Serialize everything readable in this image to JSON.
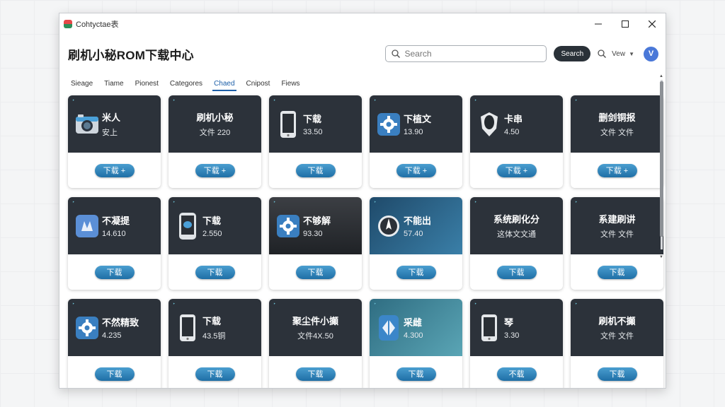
{
  "window": {
    "title": "Cohtyctae表"
  },
  "header": {
    "title": "刷机小秘ROM下载中心",
    "search_placeholder": "Search",
    "search_button": "Search",
    "view_label": "Vew",
    "avatar_letter": "V"
  },
  "tabs": [
    "Sieage",
    "Tiame",
    "Pionest",
    "Categores",
    "Chaed",
    "Cnipost",
    "Fiews"
  ],
  "active_tab": "Chaed",
  "cards": [
    {
      "title": "米人",
      "sub": "安上",
      "button": "下载 +",
      "icon": "camera-icon",
      "style": "dark"
    },
    {
      "title": "刷机小秘",
      "sub": "文件 220",
      "button": "下载 +",
      "icon": "",
      "style": "dark"
    },
    {
      "title": "下载",
      "sub": "33.50",
      "button": "下载",
      "icon": "phone-icon",
      "style": "dark"
    },
    {
      "title": "下植文",
      "sub": "13.90",
      "button": "下载 +",
      "icon": "gear-icon",
      "style": "dark"
    },
    {
      "title": "卡串",
      "sub": "4.50",
      "button": "下载 +",
      "icon": "shield-icon",
      "style": "dark"
    },
    {
      "title": "删剑铜报",
      "sub": "文件 文件",
      "button": "下载 +",
      "icon": "",
      "style": "dark"
    },
    {
      "title": "不凝提",
      "sub": "14.610",
      "button": "下载",
      "icon": "app-icon",
      "style": "dark"
    },
    {
      "title": "下载",
      "sub": "2.550",
      "button": "下载",
      "icon": "phone-msg-icon",
      "style": "dark"
    },
    {
      "title": "不够解",
      "sub": "93.30",
      "button": "下载",
      "icon": "gear-icon",
      "style": "photo"
    },
    {
      "title": "不能出",
      "sub": "57.40",
      "button": "下载",
      "icon": "compass-icon",
      "style": "blue"
    },
    {
      "title": "系统刷化分",
      "sub": "这体文文通",
      "button": "下载",
      "icon": "",
      "style": "dark"
    },
    {
      "title": "系建刷讲",
      "sub": "文件 文件",
      "button": "下载",
      "icon": "",
      "style": "dark"
    },
    {
      "title": "不然精致",
      "sub": "4.235",
      "button": "下载",
      "icon": "gear-icon",
      "style": "dark"
    },
    {
      "title": "下载",
      "sub": "43.5铜",
      "button": "下载",
      "icon": "phone-icon",
      "style": "dark"
    },
    {
      "title": "聚尘件小攧",
      "sub": "文件4X.50",
      "button": "下载",
      "icon": "",
      "style": "dark"
    },
    {
      "title": "采雌",
      "sub": "4.300",
      "button": "下载",
      "icon": "diamond-icon",
      "style": "teal"
    },
    {
      "title": "琴",
      "sub": "3.30",
      "button": "不载",
      "icon": "phone-icon",
      "style": "dark"
    },
    {
      "title": "刷机不攧",
      "sub": "文件 文件",
      "button": "下载",
      "icon": "",
      "style": "dark"
    }
  ]
}
